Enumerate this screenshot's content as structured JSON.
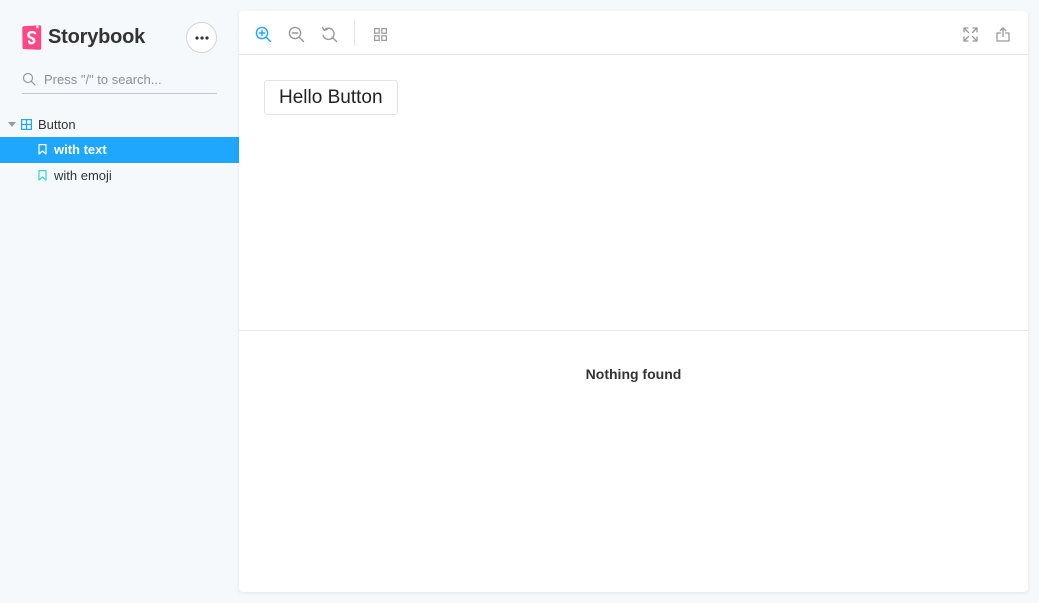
{
  "brand": {
    "name": "Storybook",
    "logo_color": "#ff4785"
  },
  "sidebar": {
    "menu_icon": "ellipsis-icon",
    "search": {
      "placeholder": "Press \"/\" to search...",
      "value": ""
    },
    "tree": {
      "group": {
        "label": "Button",
        "expanded": true
      },
      "items": [
        {
          "label": "with text",
          "selected": true
        },
        {
          "label": "with emoji",
          "selected": false
        }
      ]
    }
  },
  "toolbar": {
    "left_icons": [
      "zoom-in-icon",
      "zoom-out-icon",
      "reset-zoom-icon",
      "grid-icon"
    ],
    "right_icons": [
      "fullscreen-icon",
      "share-icon"
    ]
  },
  "preview": {
    "button_label": "Hello Button"
  },
  "addons": {
    "empty_message": "Nothing found"
  },
  "colors": {
    "accent": "#1ea7fd",
    "teal": "#37d5d3",
    "background": "#f6f9fc"
  }
}
